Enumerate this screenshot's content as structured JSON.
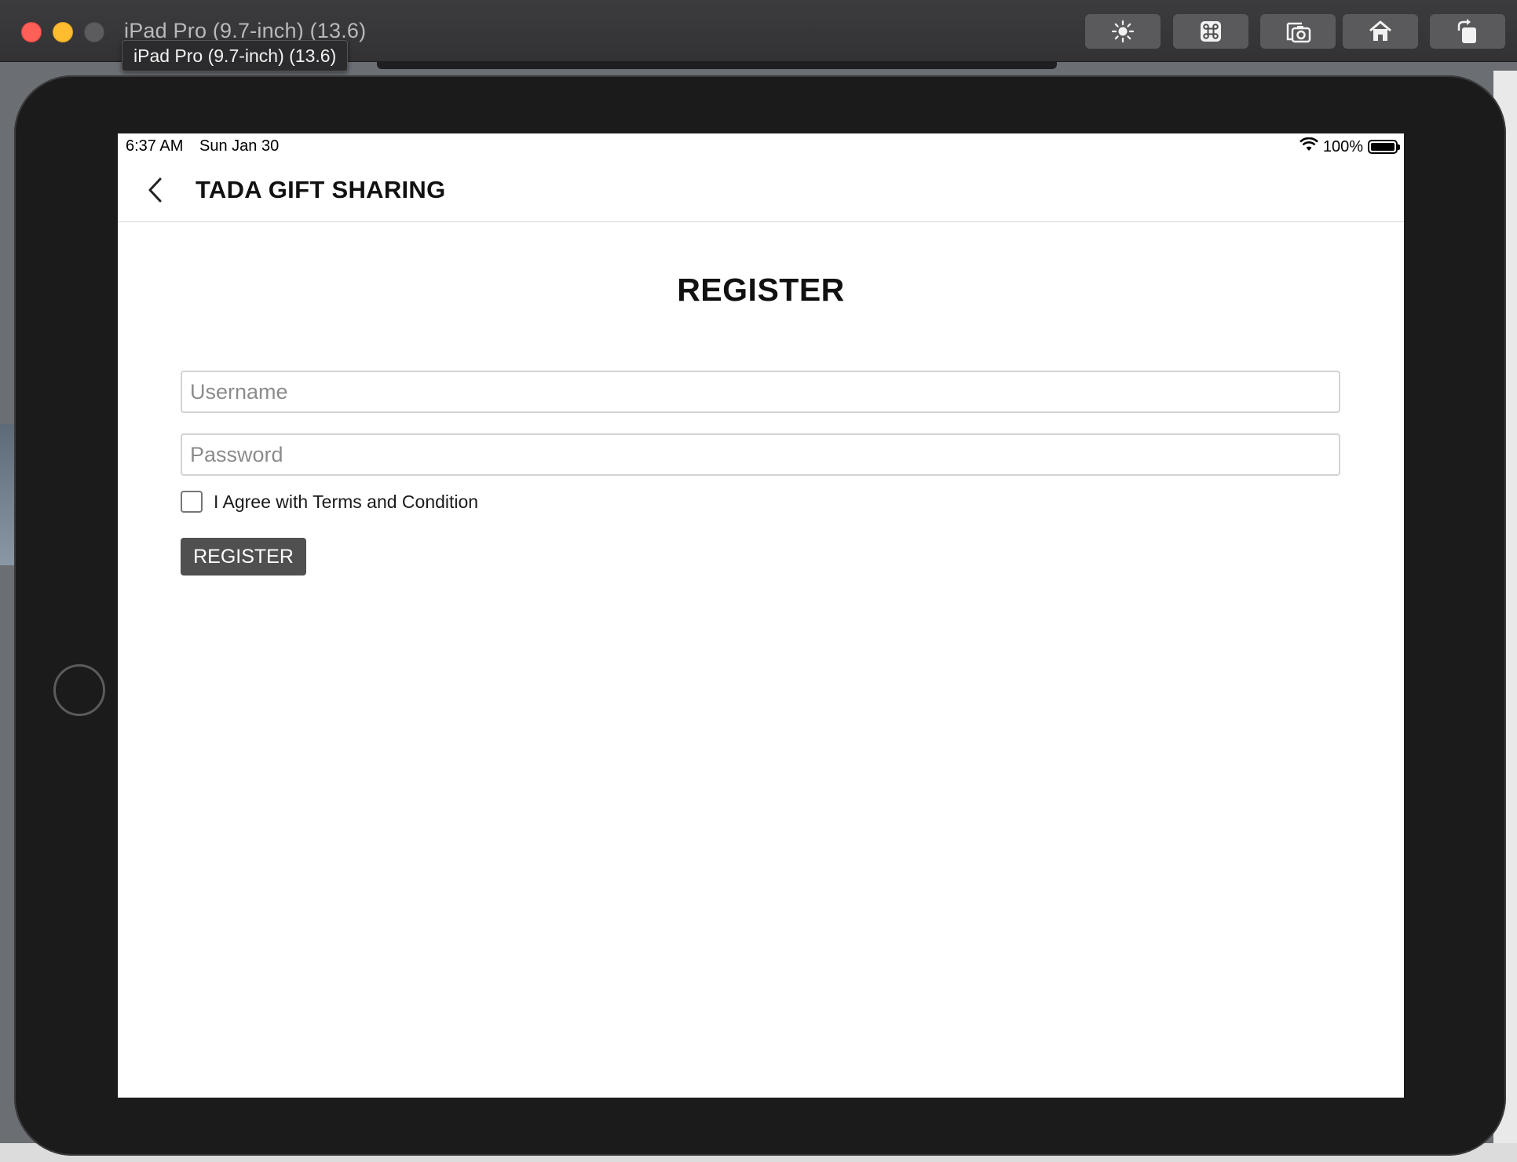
{
  "window": {
    "title": "iPad Pro (9.7-inch) (13.6)",
    "tooltip": "iPad Pro (9.7-inch) (13.6)",
    "toolbar_icons": [
      "brightness-icon",
      "command-icon",
      "screenshot-icon",
      "home-icon",
      "rotate-icon"
    ]
  },
  "status_bar": {
    "time": "6:37 AM",
    "date": "Sun Jan 30",
    "battery_percent": "100%",
    "battery_level": 1.0
  },
  "nav": {
    "title": "TADA GIFT SHARING"
  },
  "form": {
    "heading": "REGISTER",
    "username_placeholder": "Username",
    "username_value": "",
    "password_placeholder": "Password",
    "password_value": "",
    "agree_label": "I Agree with Terms and Condition",
    "agree_checked": false,
    "submit_label": "REGISTER"
  },
  "colors": {
    "button_bg": "#505050",
    "screen_bg": "#ffffff",
    "device_bezel": "#1b1b1c"
  }
}
